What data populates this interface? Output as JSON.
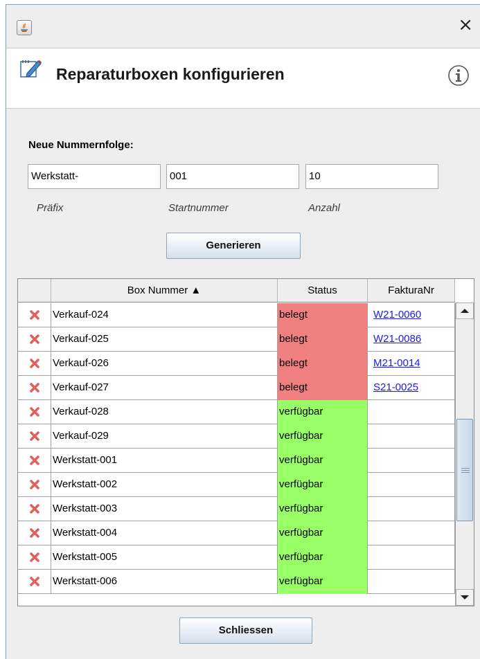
{
  "background_text": "",
  "window": {
    "close_glyph": "×"
  },
  "header": {
    "title": "Reparaturboxen konfigurieren"
  },
  "form": {
    "section_label": "Neue Nummernfolge:",
    "prefix_value": "Werkstatt-",
    "start_value": "001",
    "count_value": "10",
    "prefix_label": "Präfix",
    "start_label": "Startnummer",
    "count_label": "Anzahl",
    "generate_button": "Generieren"
  },
  "table": {
    "columns": [
      "",
      "Box Nummer ▲",
      "Status",
      "FakturaNr"
    ],
    "rows": [
      {
        "box": "Verkauf-024",
        "status": "belegt",
        "faktura": "W21-0060"
      },
      {
        "box": "Verkauf-025",
        "status": "belegt",
        "faktura": "W21-0086"
      },
      {
        "box": "Verkauf-026",
        "status": "belegt",
        "faktura": "M21-0014"
      },
      {
        "box": "Verkauf-027",
        "status": "belegt",
        "faktura": "S21-0025"
      },
      {
        "box": "Verkauf-028",
        "status": "verfügbar",
        "faktura": ""
      },
      {
        "box": "Verkauf-029",
        "status": "verfügbar",
        "faktura": ""
      },
      {
        "box": "Werkstatt-001",
        "status": "verfügbar",
        "faktura": ""
      },
      {
        "box": "Werkstatt-002",
        "status": "verfügbar",
        "faktura": ""
      },
      {
        "box": "Werkstatt-003",
        "status": "verfügbar",
        "faktura": ""
      },
      {
        "box": "Werkstatt-004",
        "status": "verfügbar",
        "faktura": ""
      },
      {
        "box": "Werkstatt-005",
        "status": "verfügbar",
        "faktura": ""
      },
      {
        "box": "Werkstatt-006",
        "status": "verfügbar",
        "faktura": ""
      }
    ],
    "status_colors": {
      "belegt": "#f08080",
      "verfügbar": "#99ff66"
    },
    "delete_icon": "delete-x-icon",
    "delete_icon_color": "#e06060"
  },
  "footer": {
    "close_button": "Schliessen"
  }
}
